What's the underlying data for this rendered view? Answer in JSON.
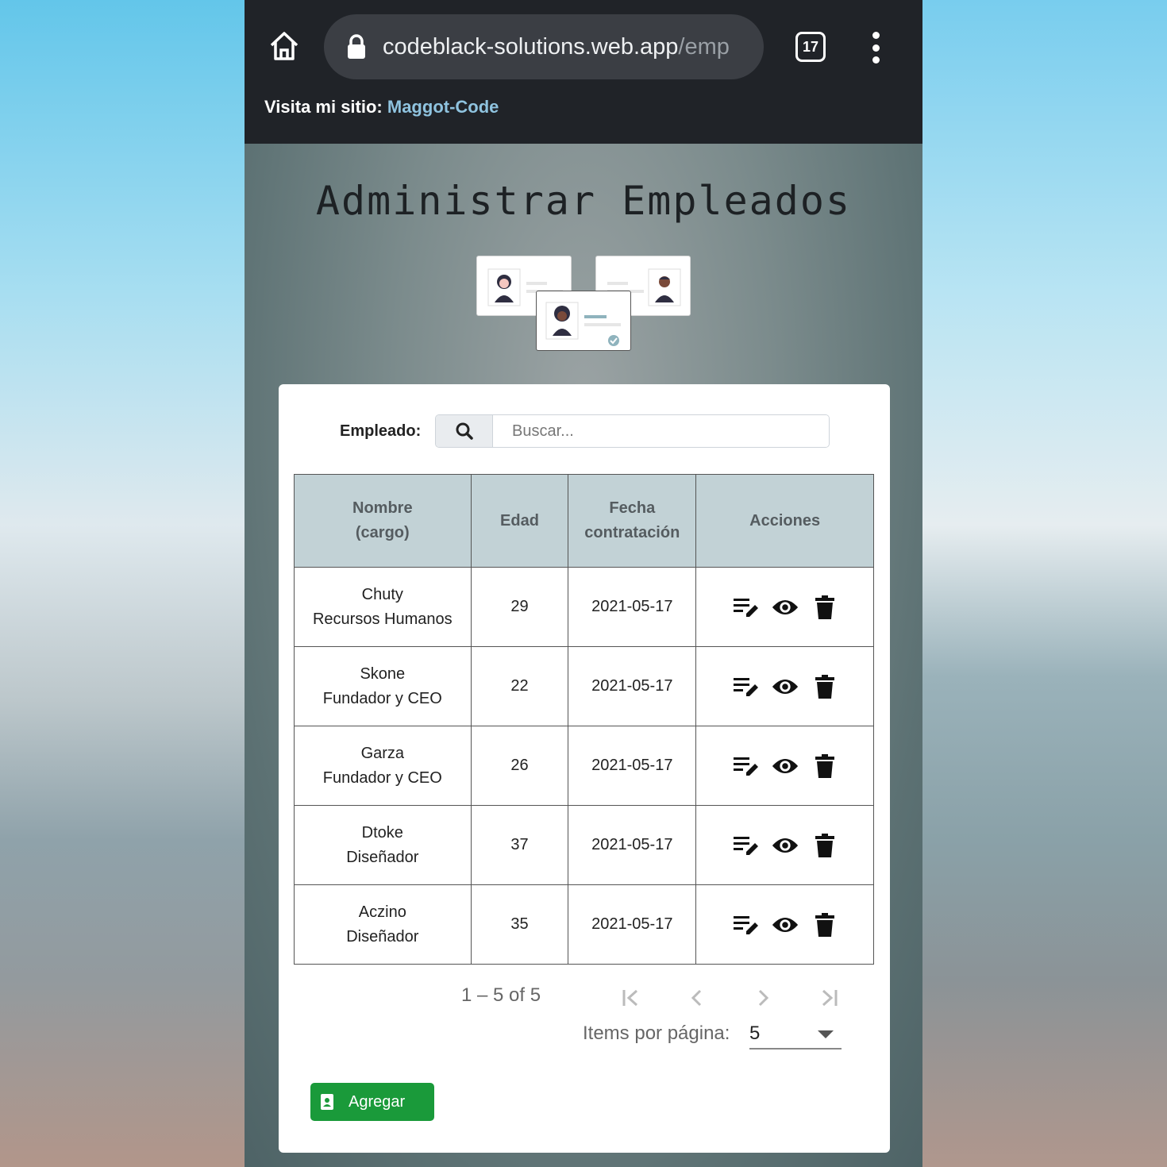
{
  "browser": {
    "url_host": "codeblack-solutions.web.app",
    "url_path": "/emp",
    "tab_count": "17"
  },
  "banner": {
    "prefix": "Visita mi sitio:",
    "link": "Maggot-Code"
  },
  "page": {
    "title": "Administrar Empleados"
  },
  "search": {
    "label": "Empleado:",
    "placeholder": "Buscar..."
  },
  "table": {
    "headers": {
      "name_line1": "Nombre",
      "name_line2": "(cargo)",
      "age": "Edad",
      "date_line1": "Fecha",
      "date_line2": "contratación",
      "actions": "Acciones"
    },
    "rows": [
      {
        "name": "Chuty",
        "role": "Recursos Humanos",
        "age": "29",
        "date": "2021-05-17"
      },
      {
        "name": "Skone",
        "role": "Fundador y CEO",
        "age": "22",
        "date": "2021-05-17"
      },
      {
        "name": "Garza",
        "role": "Fundador y CEO",
        "age": "26",
        "date": "2021-05-17"
      },
      {
        "name": "Dtoke",
        "role": "Diseñador",
        "age": "37",
        "date": "2021-05-17"
      },
      {
        "name": "Aczino",
        "role": "Diseñador",
        "age": "35",
        "date": "2021-05-17"
      }
    ],
    "row_actions": [
      "edit-note-icon",
      "eye-icon",
      "trash-icon"
    ]
  },
  "paginator": {
    "range": "1 – 5 of 5",
    "items_label": "Items por página:",
    "items_value": "5"
  },
  "add_button": {
    "label": "Agregar",
    "icon": "contact-card-icon",
    "color": "#1a9a3a"
  },
  "colors": {
    "browser_bar": "#202328",
    "table_header": "#c2d2d6",
    "link": "#8fc3df"
  }
}
